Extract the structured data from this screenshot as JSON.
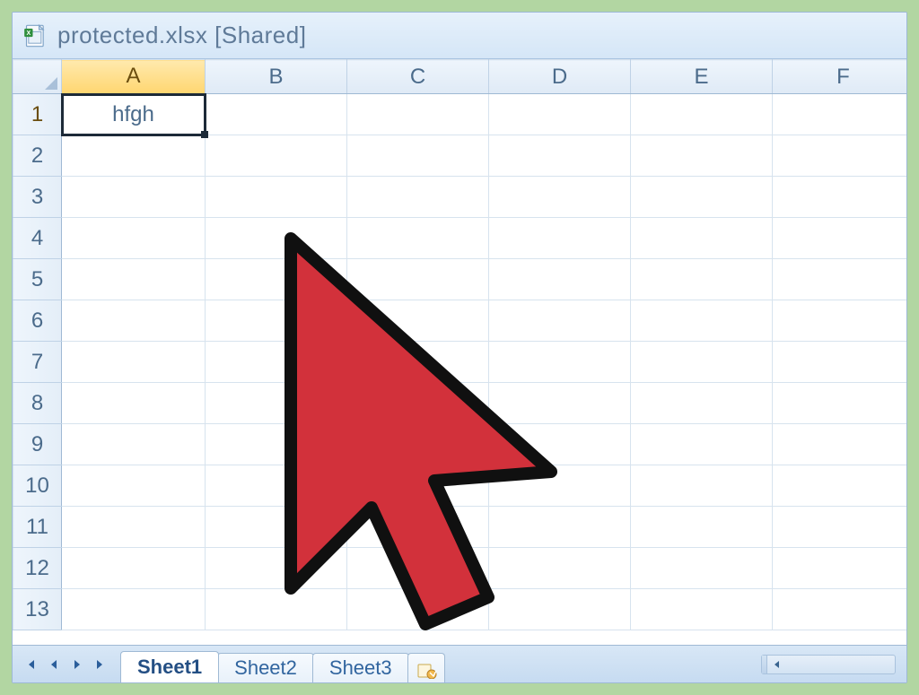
{
  "window": {
    "title": "protected.xlsx  [Shared]"
  },
  "columns": [
    "A",
    "B",
    "C",
    "D",
    "E",
    "F"
  ],
  "rows": [
    "1",
    "2",
    "3",
    "4",
    "5",
    "6",
    "7",
    "8",
    "9",
    "10",
    "11",
    "12",
    "13"
  ],
  "active_cell": {
    "col": "A",
    "row": "1",
    "value": "hfgh"
  },
  "tabs": {
    "items": [
      {
        "label": "Sheet1",
        "active": true
      },
      {
        "label": "Sheet2",
        "active": false
      },
      {
        "label": "Sheet3",
        "active": false
      }
    ]
  }
}
